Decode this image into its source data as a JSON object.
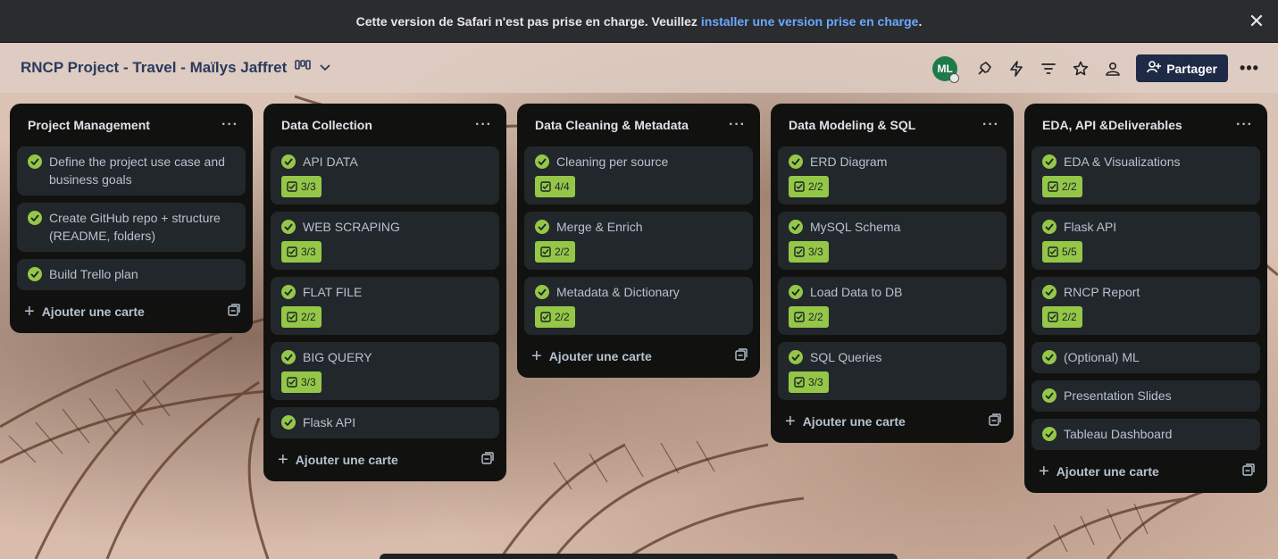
{
  "banner": {
    "text": "Cette version de Safari n'est pas prise en charge. Veuillez",
    "link_text": "installer une version prise en charge",
    "suffix": "."
  },
  "header": {
    "board_title": "RNCP Project - Travel - Maïlys Jaffret",
    "avatar_initials": "ML",
    "share_label": "Partager"
  },
  "lists": [
    {
      "title": "Project Management",
      "cards": [
        {
          "title": "Define the project use case and business goals",
          "badge": ""
        },
        {
          "title": "Create GitHub repo + structure (README, folders)",
          "badge": ""
        },
        {
          "title": "Build Trello plan",
          "badge": ""
        }
      ],
      "add_label": "Ajouter une carte"
    },
    {
      "title": "Data Collection",
      "cards": [
        {
          "title": "API DATA",
          "badge": "3/3"
        },
        {
          "title": "WEB SCRAPING",
          "badge": "3/3"
        },
        {
          "title": "FLAT FILE",
          "badge": "2/2"
        },
        {
          "title": "BIG QUERY",
          "badge": "3/3"
        },
        {
          "title": "Flask API",
          "badge": ""
        }
      ],
      "add_label": "Ajouter une carte"
    },
    {
      "title": "Data Cleaning & Metadata",
      "cards": [
        {
          "title": "Cleaning per source",
          "badge": "4/4"
        },
        {
          "title": "Merge & Enrich",
          "badge": "2/2"
        },
        {
          "title": "Metadata & Dictionary",
          "badge": "2/2"
        }
      ],
      "add_label": "Ajouter une carte"
    },
    {
      "title": "Data Modeling & SQL",
      "cards": [
        {
          "title": "ERD Diagram",
          "badge": "2/2"
        },
        {
          "title": "MySQL Schema",
          "badge": "3/3"
        },
        {
          "title": "Load Data to DB",
          "badge": "2/2"
        },
        {
          "title": "SQL Queries",
          "badge": "3/3"
        }
      ],
      "add_label": "Ajouter une carte"
    },
    {
      "title": "EDA, API &Deliverables",
      "cards": [
        {
          "title": "EDA & Visualizations",
          "badge": "2/2"
        },
        {
          "title": "Flask API",
          "badge": "5/5"
        },
        {
          "title": "RNCP Report",
          "badge": "2/2"
        },
        {
          "title": "(Optional) ML",
          "badge": ""
        },
        {
          "title": "Presentation Slides",
          "badge": ""
        },
        {
          "title": "Tableau Dashboard",
          "badge": ""
        }
      ],
      "add_label": "Ajouter une carte"
    }
  ],
  "colors": {
    "complete_green": "#94c748",
    "list_bg": "#111210",
    "card_bg": "#22272b",
    "share_bg": "#1f2b46",
    "link_blue": "#6aa8ff"
  }
}
